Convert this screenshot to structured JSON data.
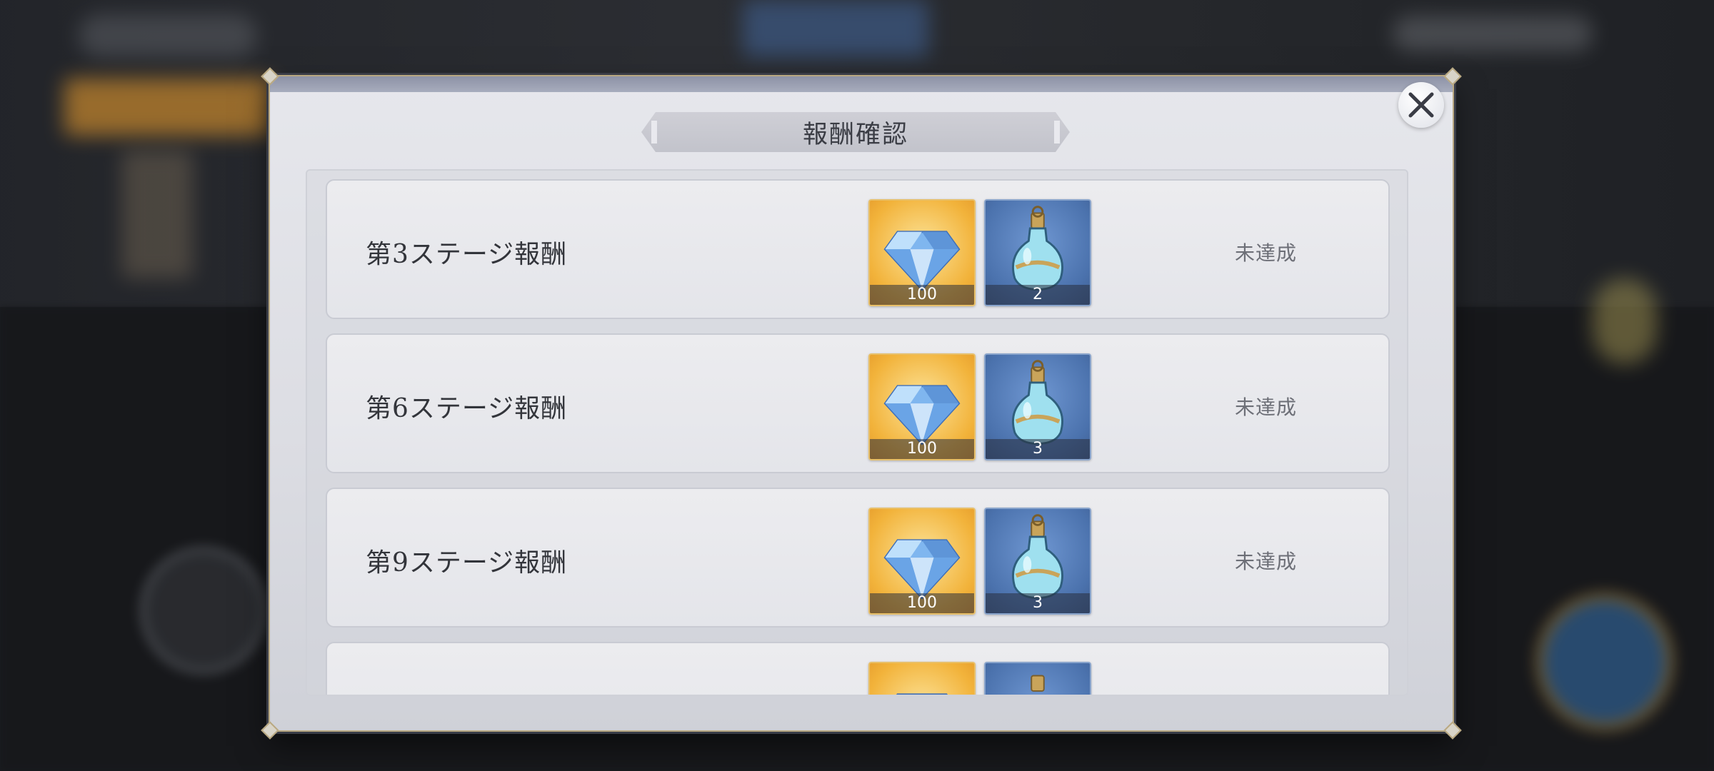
{
  "dialog": {
    "title": "報酬確認",
    "close_icon": "close-icon"
  },
  "rewards": [
    {
      "label": "第3ステージ報酬",
      "status": "未達成",
      "items": [
        {
          "icon": "diamond-gem-icon",
          "quantity": "100"
        },
        {
          "icon": "potion-bottle-icon",
          "quantity": "2"
        }
      ]
    },
    {
      "label": "第6ステージ報酬",
      "status": "未達成",
      "items": [
        {
          "icon": "diamond-gem-icon",
          "quantity": "100"
        },
        {
          "icon": "potion-bottle-icon",
          "quantity": "3"
        }
      ]
    },
    {
      "label": "第9ステージ報酬",
      "status": "未達成",
      "items": [
        {
          "icon": "diamond-gem-icon",
          "quantity": "100"
        },
        {
          "icon": "potion-bottle-icon",
          "quantity": "3"
        }
      ]
    },
    {
      "label": "",
      "status": "",
      "items": [
        {
          "icon": "diamond-gem-icon",
          "quantity": ""
        },
        {
          "icon": "potion-bottle-icon",
          "quantity": ""
        }
      ]
    }
  ],
  "colors": {
    "gem_tile": "#f2b33b",
    "potion_tile": "#4b72ad",
    "frame_gold": "#b9a881"
  }
}
